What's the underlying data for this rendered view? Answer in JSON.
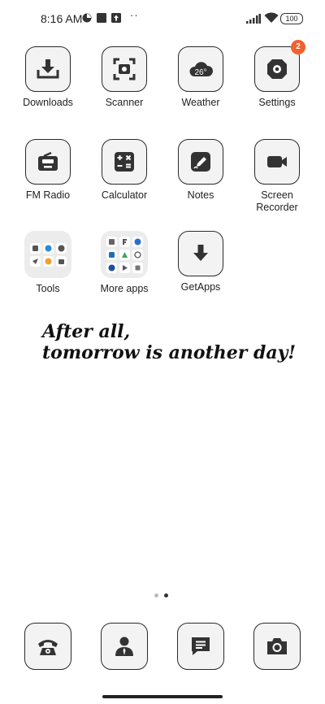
{
  "status_bar": {
    "time": "8:16 AM",
    "battery": "100"
  },
  "apps": [
    {
      "label": "Downloads",
      "icon": "download-icon"
    },
    {
      "label": "Scanner",
      "icon": "scanner-icon"
    },
    {
      "label": "Weather",
      "icon": "weather-icon",
      "icon_text": "26°"
    },
    {
      "label": "Settings",
      "icon": "gear-icon",
      "badge": "2"
    },
    {
      "label": "FM Radio",
      "icon": "radio-icon"
    },
    {
      "label": "Calculator",
      "icon": "calculator-icon"
    },
    {
      "label": "Notes",
      "icon": "notes-icon"
    },
    {
      "label": "Screen\nRecorder",
      "icon": "video-camera-icon"
    },
    {
      "label": "Tools",
      "icon": "folder-icon"
    },
    {
      "label": "More apps",
      "icon": "folder-icon"
    },
    {
      "label": "GetApps",
      "icon": "arrow-down-icon"
    }
  ],
  "quote": {
    "line1": "After all,",
    "line2": "tomorrow is another day!"
  },
  "page_indicator": {
    "pages": 2,
    "current": 2
  },
  "dock": [
    {
      "name": "phone",
      "icon": "phone-icon"
    },
    {
      "name": "contacts",
      "icon": "contacts-icon"
    },
    {
      "name": "messages",
      "icon": "message-icon"
    },
    {
      "name": "camera",
      "icon": "camera-icon"
    }
  ],
  "colors": {
    "badge": "#f0612e",
    "icon": "#333333",
    "tile_bg": "#f3f3f3"
  }
}
